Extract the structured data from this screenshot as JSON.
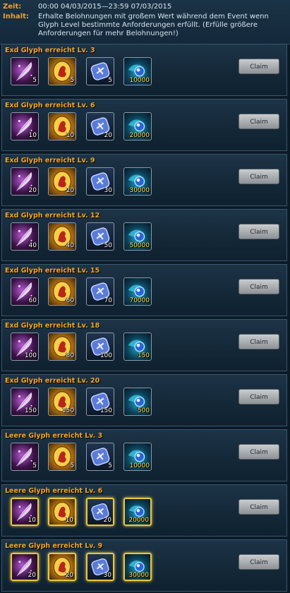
{
  "header": {
    "time_label": "Zeit:",
    "time_value": "00:00 04/03/2015—23:59 07/03/2015",
    "content_label": "Inhalt:",
    "content_value": "Erhalte Belohnungen mit großem Wert während dem Event wenn Glyph Level bestimmte Anforderungen erfüllt. (Erfülle größere Anforderungen für mehr Belohnungen!)"
  },
  "claim_label": "Claim",
  "rows": [
    {
      "title": "Exd Glyph erreicht Lv. 3",
      "qty": [
        "5",
        "5",
        "5",
        "10000"
      ]
    },
    {
      "title": "Exd Glyph erreicht Lv. 6",
      "qty": [
        "10",
        "10",
        "20",
        "20000"
      ]
    },
    {
      "title": "Exd Glyph erreicht Lv. 9",
      "qty": [
        "20",
        "20",
        "30",
        "30000"
      ]
    },
    {
      "title": "Exd Glyph erreicht Lv. 12",
      "qty": [
        "40",
        "40",
        "50",
        "50000"
      ]
    },
    {
      "title": "Exd Glyph erreicht Lv. 15",
      "qty": [
        "60",
        "60",
        "70",
        "70000"
      ]
    },
    {
      "title": "Exd Glyph erreicht Lv. 18",
      "qty": [
        "100",
        "80",
        "100",
        "150"
      ]
    },
    {
      "title": "Exd Glyph erreicht Lv. 20",
      "qty": [
        "150",
        "150",
        "150",
        "500"
      ]
    },
    {
      "title": "Leere Glyph erreicht Lv. 3",
      "qty": [
        "5",
        "5",
        "5",
        "10000"
      ]
    },
    {
      "title": "Leere Glyph erreicht Lv. 6",
      "qty": [
        "10",
        "10",
        "20",
        "20000"
      ]
    },
    {
      "title": "Leere Glyph erreicht Lv. 9",
      "qty": [
        "20",
        "20",
        "30",
        "30000"
      ]
    }
  ],
  "item_icons": [
    "feather-icon",
    "gold-emblem-icon",
    "rune-stone-icon",
    "blue-orb-icon"
  ],
  "colors": {
    "title": "#f5a623",
    "label": "#f0a030",
    "gold_border": "#e8c640"
  }
}
